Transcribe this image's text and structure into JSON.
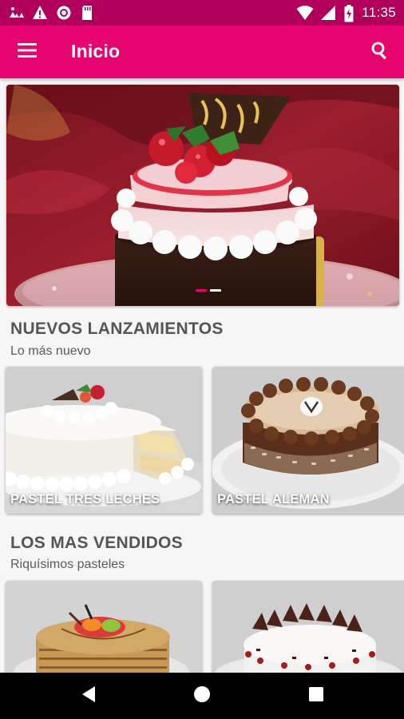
{
  "status_bar": {
    "time": "11:35",
    "icons": [
      "weather-icon",
      "warning-icon",
      "record-icon",
      "sd-card-icon",
      "wifi-icon",
      "signal-icon",
      "battery-icon"
    ]
  },
  "app_bar": {
    "title": "Inicio",
    "menu_icon": "hamburger-menu-icon",
    "search_icon": "search-icon",
    "color": "#e6056f"
  },
  "hero": {
    "active_slide": 1,
    "slide_count": 2
  },
  "sections": [
    {
      "title": "NUEVOS LANZAMIENTOS",
      "subtitle": "Lo más nuevo",
      "items": [
        {
          "label": "PASTEL TRES LECHES"
        },
        {
          "label": "PASTEL ALEMAN"
        }
      ]
    },
    {
      "title": "LOS MAS VENDIDOS",
      "subtitle": "Riquísimos pasteles",
      "items": [
        {
          "label": ""
        },
        {
          "label": ""
        }
      ]
    }
  ],
  "nav_bar": {
    "icons": [
      "back-icon",
      "home-icon",
      "recents-icon"
    ]
  }
}
